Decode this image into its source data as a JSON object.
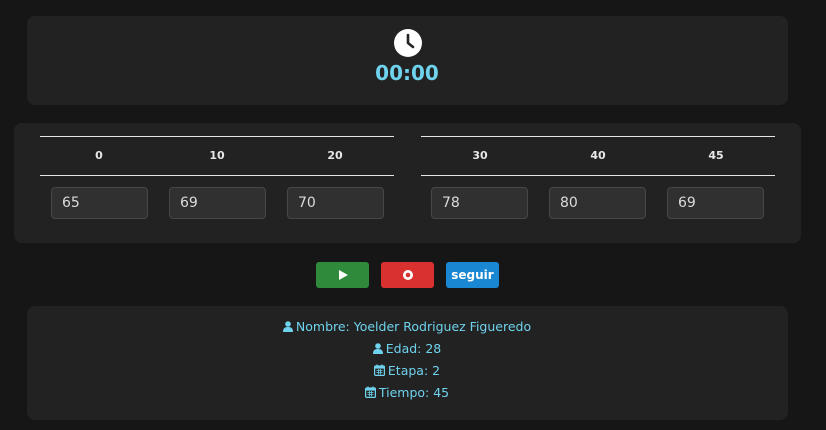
{
  "timer": {
    "icon": "clock-icon",
    "display": "00:00"
  },
  "table": {
    "left_group": {
      "headers": [
        "0",
        "10",
        "20"
      ],
      "values": [
        "65",
        "69",
        "70"
      ]
    },
    "right_group": {
      "headers": [
        "30",
        "40",
        "45"
      ],
      "values": [
        "78",
        "80",
        "69"
      ]
    }
  },
  "controls": {
    "play_icon": "play-icon",
    "record_icon": "record-icon",
    "next_label": "seguir"
  },
  "info": {
    "name_label": "Nombre: Yoelder Rodriguez Figueredo",
    "age_label": "Edad: 28",
    "stage_label": "Etapa: 2",
    "time_label": "Tiempo: 45"
  },
  "colors": {
    "accent": "#6fd3ee",
    "play": "#2f8a3b",
    "record": "#d93030",
    "next": "#1a87d2"
  }
}
